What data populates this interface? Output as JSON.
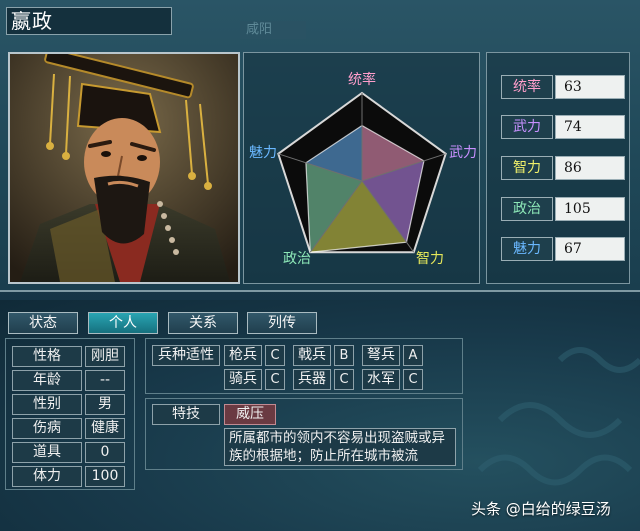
{
  "officer": {
    "name": "嬴政",
    "city": "咸阳"
  },
  "radar": {
    "labels": {
      "top": "统率",
      "right": "武力",
      "bottom_right": "智力",
      "bottom_left": "政治",
      "left": "魅力"
    },
    "colors": {
      "leadership": "#ff9ecb",
      "war": "#c890ff",
      "intelligence": "#e6e85a",
      "politics": "#8de8b8",
      "charm": "#6ab8ff"
    },
    "max": 100
  },
  "stats": [
    {
      "key": "leadership",
      "label": "统率",
      "value": 63,
      "color": "#ff9ecb"
    },
    {
      "key": "war",
      "label": "武力",
      "value": 74,
      "color": "#c890ff"
    },
    {
      "key": "intelligence",
      "label": "智力",
      "value": 86,
      "color": "#f0f06a"
    },
    {
      "key": "politics",
      "label": "政治",
      "value": 105,
      "color": "#8de8b8"
    },
    {
      "key": "charm",
      "label": "魅力",
      "value": 67,
      "color": "#6ab8ff"
    }
  ],
  "tabs": [
    {
      "label": "状态",
      "active": false
    },
    {
      "label": "个人",
      "active": true
    },
    {
      "label": "关系",
      "active": false
    },
    {
      "label": "列传",
      "active": false
    }
  ],
  "personal": [
    {
      "label": "性格",
      "value": "刚胆"
    },
    {
      "label": "年龄",
      "value": "--"
    },
    {
      "label": "性别",
      "value": "男"
    },
    {
      "label": "伤病",
      "value": "健康"
    },
    {
      "label": "道具",
      "value": "0"
    },
    {
      "label": "体力",
      "value": "100"
    }
  ],
  "aptitude": {
    "title": "兵种适性",
    "units": [
      {
        "unit": "枪兵",
        "grade": "C"
      },
      {
        "unit": "戟兵",
        "grade": "B"
      },
      {
        "unit": "弩兵",
        "grade": "A"
      },
      {
        "unit": "骑兵",
        "grade": "C"
      },
      {
        "unit": "兵器",
        "grade": "C"
      },
      {
        "unit": "水军",
        "grade": "C"
      }
    ]
  },
  "skill": {
    "label": "特技",
    "name": "威压",
    "description": "所属都市的领内不容易出现盗贼或异族的根据地；防止所在城市被流"
  },
  "watermark": "头条 @白给的绿豆汤"
}
